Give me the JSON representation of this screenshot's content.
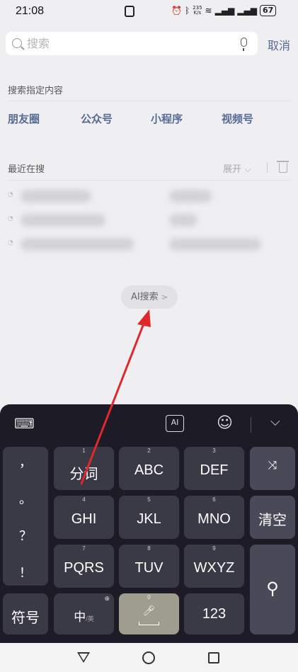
{
  "status_bar": {
    "time": "21:08",
    "net_speed_value": "235",
    "net_speed_unit": "K/s",
    "battery": "67"
  },
  "search": {
    "placeholder": "搜索",
    "cancel_label": "取消"
  },
  "specific": {
    "label": "搜索指定内容",
    "categories": [
      "朋友圈",
      "公众号",
      "小程序",
      "视频号"
    ]
  },
  "recent": {
    "label": "最近在搜",
    "expand_label": "展开"
  },
  "ai_search": {
    "label": "AI搜索"
  },
  "keyboard": {
    "punctuation": [
      "，",
      "。",
      "？",
      "！"
    ],
    "keys": [
      {
        "num": "1",
        "label": "分词"
      },
      {
        "num": "2",
        "label": "ABC"
      },
      {
        "num": "3",
        "label": "DEF"
      },
      {
        "num": "4",
        "label": "GHI"
      },
      {
        "num": "5",
        "label": "JKL"
      },
      {
        "num": "6",
        "label": "MNO"
      },
      {
        "num": "7",
        "label": "PQRS"
      },
      {
        "num": "8",
        "label": "TUV"
      },
      {
        "num": "9",
        "label": "WXYZ"
      }
    ],
    "clear_label": "清空",
    "symbols_label": "符号",
    "lang_main": "中",
    "lang_alt": "/英",
    "space_num": "0",
    "numbers_label": "123"
  },
  "colors": {
    "accent": "#576b95",
    "annotation_arrow": "#e0282c",
    "keyboard_bg": "#1d1c26"
  }
}
